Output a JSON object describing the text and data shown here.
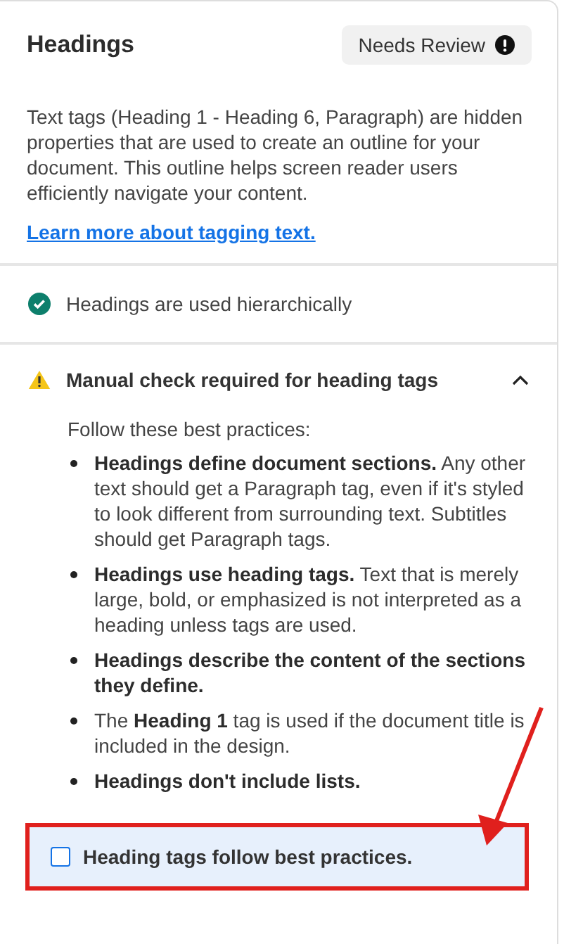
{
  "panel": {
    "title": "Headings",
    "status": {
      "label": "Needs Review"
    },
    "description": "Text tags (Heading 1 - Heading 6, Paragraph) are hidden properties that are used to create an outline for your document. This outline helps screen reader users efficiently navigate your content.",
    "link": "Learn more about tagging text.",
    "checks": [
      {
        "kind": "passed",
        "label": "Headings are used hierarchically"
      }
    ],
    "manual": {
      "title": "Manual check required for heading tags",
      "expanded": true,
      "intro": "Follow these best practices:",
      "items": [
        "**Headings define document sections.** Any other text should get a Paragraph tag, even if it's styled to look different from surrounding text. Subtitles should get Paragraph tags.",
        "**Headings use heading tags.** Text that is merely large, bold, or emphasized is not interpreted as a heading unless tags are used.",
        "**Headings describe the content of the sections they define.**",
        "The **Heading 1** tag is used if the document title is included in the design.",
        "**Headings don't include lists.**"
      ],
      "checkbox": {
        "label": "Heading tags follow best practices.",
        "checked": false,
        "highlighted": true
      }
    }
  }
}
